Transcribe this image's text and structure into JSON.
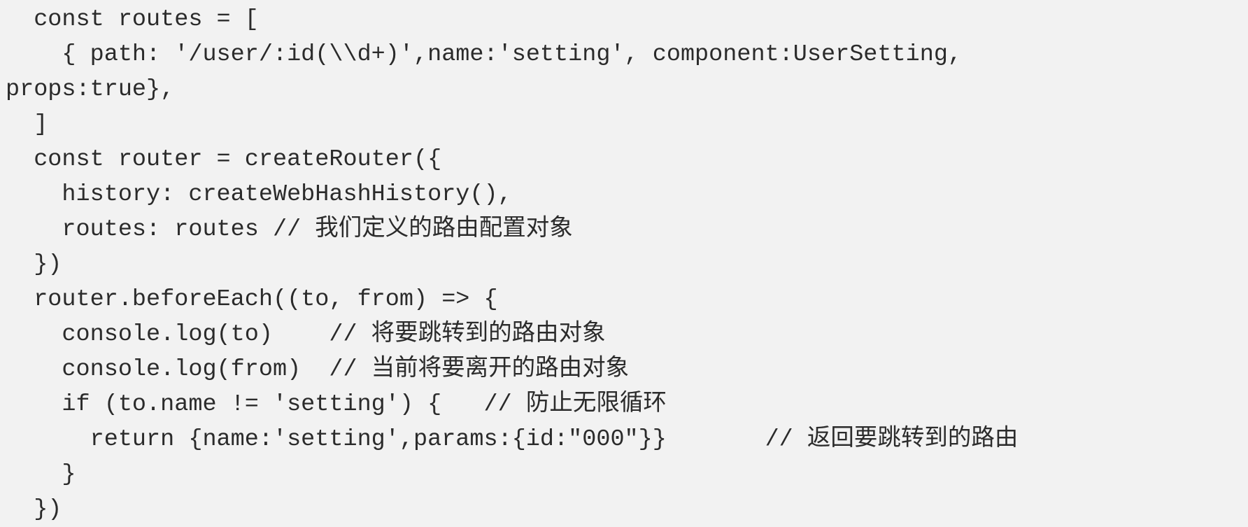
{
  "editor": {
    "background_color": "#f2f2f2",
    "text_color": "#2b2b2b",
    "lines": [
      "  const routes = [",
      "    { path: '/user/:id(\\\\d+)',name:'setting', component:UserSetting,",
      "props:true},",
      "  ]",
      "  const router = createRouter({",
      "    history: createWebHashHistory(),",
      "    routes: routes // 我们定义的路由配置对象",
      "  })",
      "  router.beforeEach((to, from) => {",
      "    console.log(to)    // 将要跳转到的路由对象",
      "    console.log(from)  // 当前将要离开的路由对象",
      "    if (to.name != 'setting') {   // 防止无限循环",
      "      return {name:'setting',params:{id:\"000\"}}       // 返回要跳转到的路由",
      "    }",
      "  })"
    ]
  }
}
